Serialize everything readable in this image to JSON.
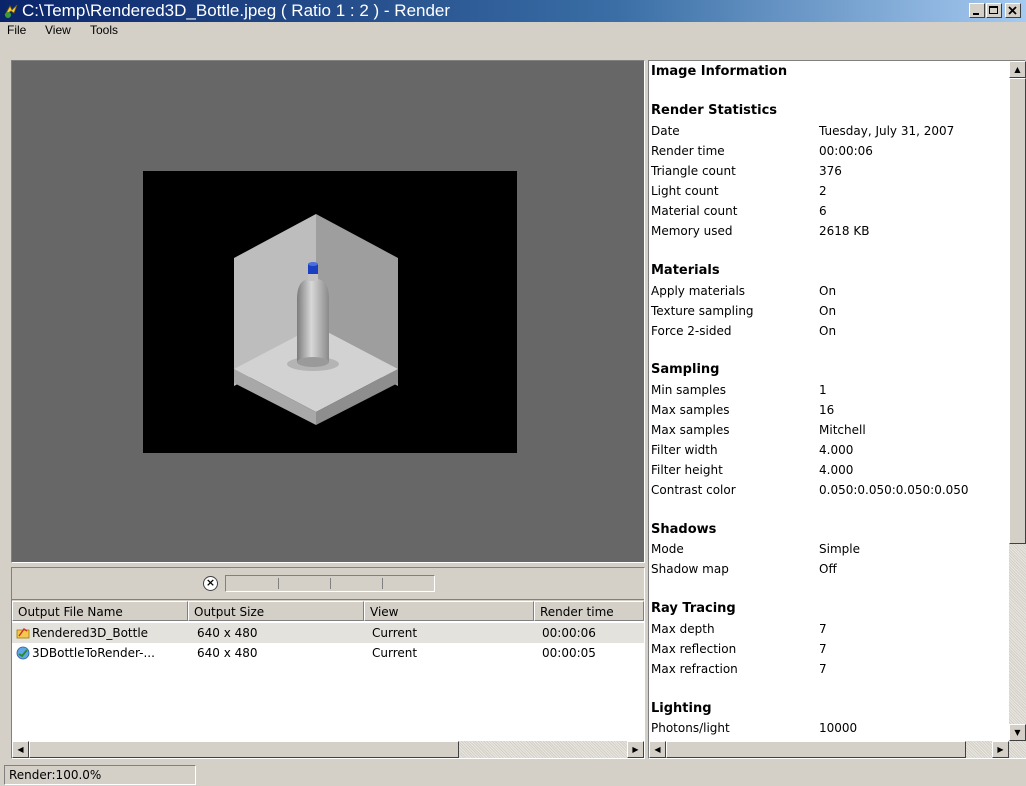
{
  "window": {
    "title": "C:\\Temp\\Rendered3D_Bottle.jpeg  ( Ratio 1 : 2 ) - Render",
    "minimize": "_",
    "maximize": "□",
    "close": "×"
  },
  "menu": [
    "File",
    "View",
    "Tools"
  ],
  "queue": {
    "cancel_icon": "×",
    "columns": [
      "Output File Name",
      "Output Size",
      "View",
      "Render time"
    ],
    "rows": [
      {
        "name": "Rendered3D_Bottle",
        "size": "640 x 480",
        "view": "Current",
        "time": "00:00:06",
        "icon": "folder-icon"
      },
      {
        "name": "3DBottleToRender-...",
        "size": "640 x 480",
        "view": "Current",
        "time": "00:00:05",
        "icon": "render-icon"
      }
    ]
  },
  "info": {
    "title": "Image Information",
    "sections": {
      "render_statistics": {
        "heading": "Render Statistics",
        "rows": [
          {
            "label": "Date",
            "value": "Tuesday, July 31, 2007"
          },
          {
            "label": "Render time",
            "value": "00:00:06"
          },
          {
            "label": "Triangle count",
            "value": "376"
          },
          {
            "label": "Light count",
            "value": "2"
          },
          {
            "label": "Material count",
            "value": "6"
          },
          {
            "label": "Memory used",
            "value": "2618 KB"
          }
        ]
      },
      "materials": {
        "heading": "Materials",
        "rows": [
          {
            "label": "Apply materials",
            "value": "On"
          },
          {
            "label": "Texture sampling",
            "value": "On"
          },
          {
            "label": "Force 2-sided",
            "value": "On"
          }
        ]
      },
      "sampling": {
        "heading": "Sampling",
        "rows": [
          {
            "label": "Min samples",
            "value": "1"
          },
          {
            "label": "Max samples",
            "value": "16"
          },
          {
            "label": "Max samples",
            "value": "Mitchell"
          },
          {
            "label": "Filter width",
            "value": "4.000"
          },
          {
            "label": "Filter height",
            "value": "4.000"
          },
          {
            "label": "Contrast color",
            "value": "0.050:0.050:0.050:0.050"
          }
        ]
      },
      "shadows": {
        "heading": "Shadows",
        "rows": [
          {
            "label": "Mode",
            "value": "Simple"
          },
          {
            "label": "Shadow map",
            "value": "Off"
          }
        ]
      },
      "ray_tracing": {
        "heading": "Ray Tracing",
        "rows": [
          {
            "label": "Max depth",
            "value": "7"
          },
          {
            "label": "Max reflection",
            "value": "7"
          },
          {
            "label": "Max refraction",
            "value": "7"
          }
        ]
      },
      "lighting": {
        "heading": "Lighting",
        "rows": [
          {
            "label": "Photons/light",
            "value": "10000"
          }
        ]
      }
    }
  },
  "status": {
    "text": "Render:100.0%"
  },
  "colors": {
    "titlebar_start": "#0a246a",
    "titlebar_end": "#a6caf0",
    "viewport_bg": "#676767",
    "bottle_cap": "#1a3fc0"
  }
}
